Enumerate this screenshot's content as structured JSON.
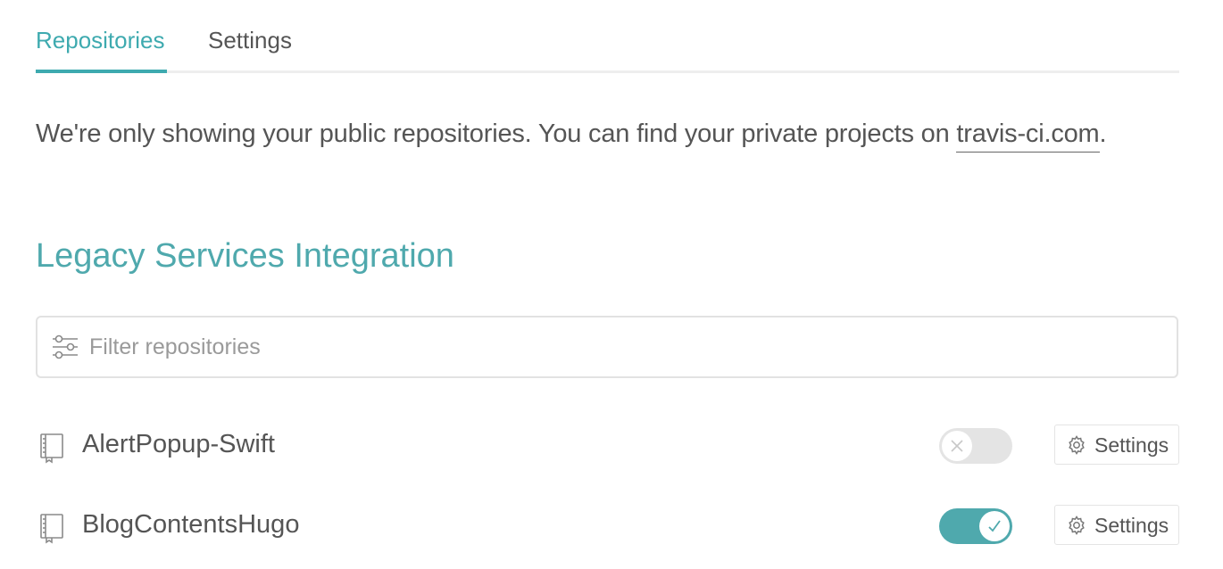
{
  "tabs": [
    {
      "label": "Repositories",
      "active": true
    },
    {
      "label": "Settings",
      "active": false
    }
  ],
  "notice": {
    "text": "We're only showing your public repositories. You can find your private projects on ",
    "link_text": "travis-ci.com",
    "suffix": "."
  },
  "org": {
    "title": "Legacy Services Integration"
  },
  "filter": {
    "placeholder": "Filter repositories",
    "value": "",
    "icon": "sliders-icon"
  },
  "repos": [
    {
      "name": "AlertPopup-Swift",
      "enabled": false,
      "settings_label": "Settings",
      "icon": "repo-book-icon"
    },
    {
      "name": "BlogContentsHugo",
      "enabled": true,
      "settings_label": "Settings",
      "icon": "repo-book-icon"
    }
  ],
  "colors": {
    "accent": "#3eaaaf",
    "toggle_on": "#4fa9ad",
    "toggle_off": "#e4e4e4",
    "text": "#555555"
  }
}
